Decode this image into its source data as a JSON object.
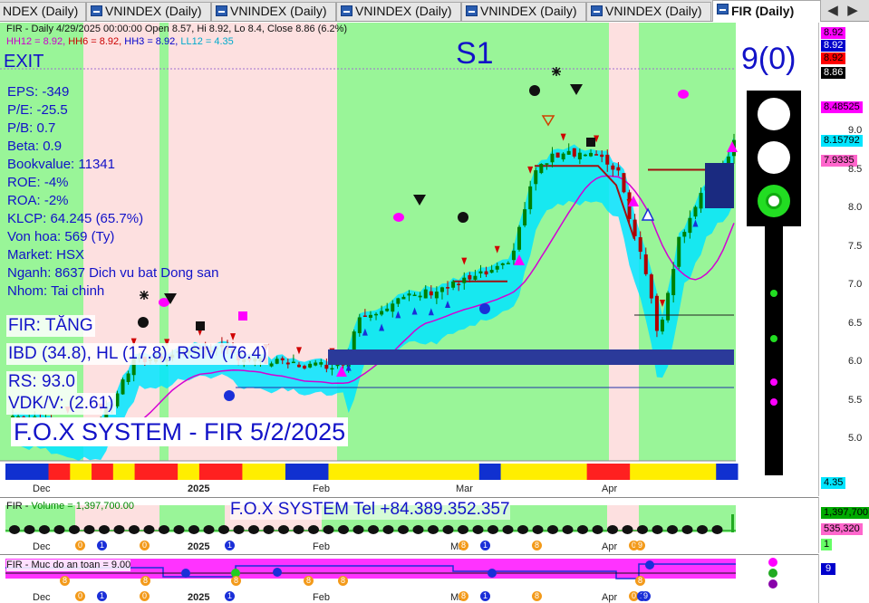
{
  "tabs": [
    {
      "label": "NDEX (Daily)"
    },
    {
      "label": "VNINDEX (Daily)"
    },
    {
      "label": "VNINDEX (Daily)"
    },
    {
      "label": "VNINDEX (Daily)"
    },
    {
      "label": "VNINDEX (Daily)"
    },
    {
      "label": "VNINDEX (Daily)"
    },
    {
      "label": "FIR (Daily)"
    }
  ],
  "price_pane": {
    "header_line": "FIR - Daily 4/29/2025 00:00:00 Open 8.57, Hi 8.92, Lo 8.4, Close 8.86 (6.2%)",
    "hh_parts": [
      "HH12 = 8.92, ",
      "HH6 = 8.92, ",
      "HH3 = 8.92, ",
      "LL12 = 4.35"
    ],
    "exit_label": "EXIT",
    "signal_label": "S1",
    "score_label": "9(0)",
    "fundamentals": [
      "EPS: -349",
      "P/E: -25.5",
      "P/B: 0.7",
      "Beta: 0.9",
      "Bookvalue: 11341",
      "ROE: -4%",
      "ROA: -2%",
      "KLCP: 64.245 (65.7%)",
      "Von hoa: 569 (Ty)",
      "Market: HSX",
      "Nganh: 8637 Dich vu bat Dong san",
      "Nhom: Tai chinh"
    ],
    "trend_label": "FIR: TĂNG",
    "ibd_label": "IBD (34.8), HL (17.8), RSIV (76.4)",
    "rs_label": "RS: 93.0",
    "vdk_label": "VDK/V:  (2.61)",
    "brand_label": "F.O.X SYSTEM - FIR 5/2/2025",
    "right_labels": [
      {
        "text": "8.92",
        "bg": "#ff00ff",
        "fg": "#000000"
      },
      {
        "text": "8.92",
        "bg": "#0000cc",
        "fg": "#ffffff"
      },
      {
        "text": "8.92",
        "bg": "#ff0000",
        "fg": "#000000"
      },
      {
        "text": "8.86",
        "bg": "#000000",
        "fg": "#ffffff"
      },
      {
        "text": "8.48525",
        "bg": "#ff00ff",
        "fg": "#000000"
      },
      {
        "text": "8.15792",
        "bg": "#00e5ff",
        "fg": "#000000"
      },
      {
        "text": "7.9335",
        "bg": "#ff66cc",
        "fg": "#000000"
      },
      {
        "text": "4.35",
        "bg": "#00e5ff",
        "fg": "#000000"
      }
    ],
    "ticks": [
      "9.0",
      "8.5",
      "8.0",
      "7.5",
      "7.0",
      "6.5",
      "6.0",
      "5.5",
      "5.0"
    ],
    "dates": [
      {
        "text": "Dec",
        "bold": false
      },
      {
        "text": "2025",
        "bold": true
      },
      {
        "text": "Feb",
        "bold": false
      },
      {
        "text": "Mar",
        "bold": false
      },
      {
        "text": "Apr",
        "bold": false
      }
    ]
  },
  "volume_pane": {
    "header_prefix": "FIR - ",
    "header_volume": "Volume = 1,397,700.00",
    "contact_label": "F.O.X SYSTEM Tel +84.389.352.357",
    "right_labels": [
      {
        "text": "1,397,700",
        "bg": "#00aa00",
        "fg": "#000000"
      },
      {
        "text": "535,320",
        "bg": "#ff66cc",
        "fg": "#000000"
      },
      {
        "text": "1",
        "bg": "#66ff66",
        "fg": "#000000"
      }
    ],
    "dates": [
      "Dec",
      "2025",
      "Feb",
      "Ma",
      "Apr"
    ],
    "badges": [
      "0",
      "1",
      "0",
      "1",
      "8",
      "1",
      "8",
      "0",
      "9"
    ]
  },
  "safety_pane": {
    "header": "FIR - Muc do an toan = 9.00",
    "right_label": {
      "text": "9",
      "bg": "#0000cc",
      "fg": "#ffffff"
    },
    "dates": [
      "Dec",
      "2025",
      "Feb",
      "Ma",
      "Apr"
    ],
    "badges": [
      "8",
      "8",
      "8",
      "8",
      "8",
      "0",
      "1",
      "0",
      "1",
      "8",
      "1",
      "8",
      "0",
      "8",
      "1",
      "9"
    ]
  },
  "colors": {
    "bull_zone": "#99f598",
    "bear_zone": "#fde0e0",
    "up_candle": "#008000",
    "down_candle": "#b00000",
    "band": "#00e5ff",
    "ma_line": "#d400d4",
    "accent_blue": "#1212c8"
  }
}
